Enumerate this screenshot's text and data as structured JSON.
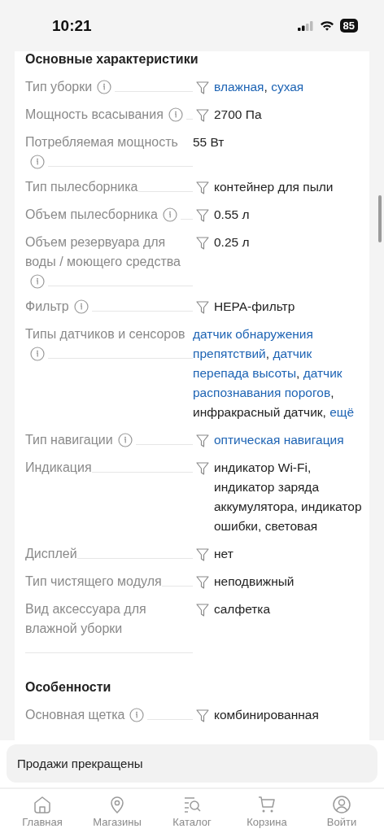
{
  "status_bar": {
    "time": "10:21",
    "battery": "85"
  },
  "sections": [
    {
      "title": "Основные характеристики",
      "rows": [
        {
          "label": "Тип уборки",
          "info": true,
          "filter": true,
          "value": [
            {
              "text": "влажная",
              "link": true
            },
            {
              "text": ", ",
              "link": false
            },
            {
              "text": "сухая",
              "link": true
            }
          ]
        },
        {
          "label": "Мощность всасывания",
          "info": true,
          "filter": true,
          "value": [
            {
              "text": "2700 Па",
              "link": false
            }
          ]
        },
        {
          "label": "Потребляемая мощность",
          "info": true,
          "filter": false,
          "value": [
            {
              "text": "55 Вт",
              "link": false
            }
          ]
        },
        {
          "label": "Тип пылесборника",
          "info": false,
          "filter": true,
          "value": [
            {
              "text": "контейнер для пыли",
              "link": false
            }
          ]
        },
        {
          "label": "Объем пылесборника",
          "info": true,
          "filter": true,
          "value": [
            {
              "text": "0.55 л",
              "link": false
            }
          ]
        },
        {
          "label": "Объем резервуара для воды / моющего средства",
          "info": true,
          "filter": true,
          "value": [
            {
              "text": "0.25 л",
              "link": false
            }
          ]
        },
        {
          "label": "Фильтр",
          "info": true,
          "filter": true,
          "value": [
            {
              "text": "HEPA-фильтр",
              "link": false
            }
          ]
        },
        {
          "label": "Типы датчиков и сенсоров",
          "info": true,
          "filter": false,
          "value": [
            {
              "text": "датчик обнаружения препятствий",
              "link": true
            },
            {
              "text": ", ",
              "link": false
            },
            {
              "text": "датчик перепада высоты",
              "link": true
            },
            {
              "text": ", ",
              "link": false
            },
            {
              "text": "датчик распознавания порогов",
              "link": true
            },
            {
              "text": ", инфракрасный датчик, ",
              "link": false
            },
            {
              "text": "ещё",
              "link": true
            }
          ]
        },
        {
          "label": "Тип навигации",
          "info": true,
          "filter": true,
          "value": [
            {
              "text": "оптическая навигация",
              "link": true
            }
          ]
        },
        {
          "label": "Индикация",
          "info": false,
          "filter": true,
          "value": [
            {
              "text": "индикатор Wi-Fi, индикатор заряда аккумулятора, индикатор ошибки, световая",
              "link": false
            }
          ]
        },
        {
          "label": "Дисплей",
          "info": false,
          "filter": true,
          "value": [
            {
              "text": "нет",
              "link": false
            }
          ]
        },
        {
          "label": "Тип чистящего модуля",
          "info": false,
          "filter": true,
          "value": [
            {
              "text": "неподвижный",
              "link": false
            }
          ]
        },
        {
          "label": "Вид аксессуара для влажной уборки",
          "info": false,
          "filter": true,
          "value": [
            {
              "text": "салфетка",
              "link": false
            }
          ]
        }
      ]
    },
    {
      "title": "Особенности",
      "rows": [
        {
          "label": "Основная щетка",
          "info": true,
          "filter": true,
          "value": [
            {
              "text": "комбинированная",
              "link": false
            }
          ]
        }
      ]
    }
  ],
  "notice": "Продажи прекращены",
  "tabs": [
    {
      "label": "Главная"
    },
    {
      "label": "Магазины"
    },
    {
      "label": "Каталог"
    },
    {
      "label": "Корзина"
    },
    {
      "label": "Войти"
    }
  ]
}
